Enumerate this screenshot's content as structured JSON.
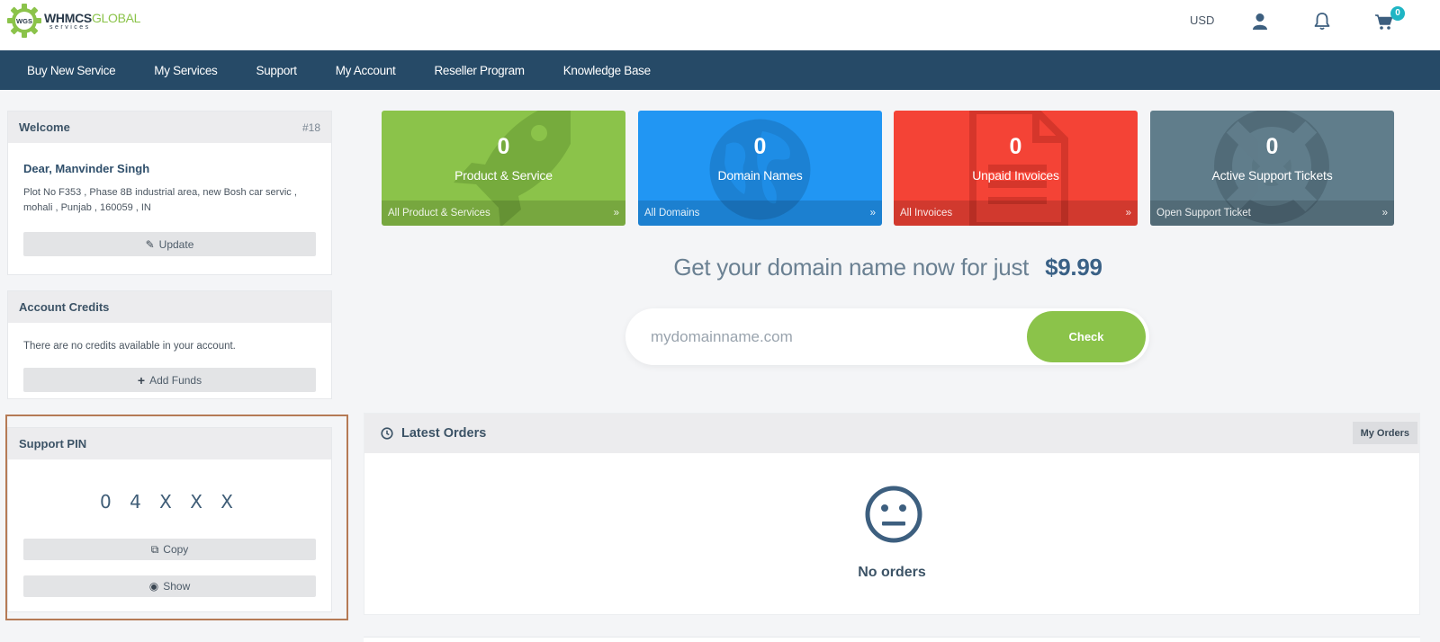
{
  "brand": {
    "name_main": "WHMCS",
    "name_accent": "GLOBAL",
    "tagline": "services",
    "badge": "WGS"
  },
  "header": {
    "currency": "USD",
    "cart_count": "0"
  },
  "nav": [
    "Buy New Service",
    "My Services",
    "Support",
    "My Account",
    "Reseller Program",
    "Knowledge Base"
  ],
  "welcome": {
    "title": "Welcome",
    "client_id": "#18",
    "name": "Dear, Manvinder Singh",
    "address": "Plot No F353 , Phase 8B industrial area, new Bosh car servic , mohali , Punjab , 160059 , IN",
    "update_label": "Update"
  },
  "credits": {
    "title": "Account Credits",
    "message": "There are no credits available in your account.",
    "add_funds_label": "Add Funds"
  },
  "support_pin": {
    "title": "Support PIN",
    "value": "0 4 X X X",
    "copy_label": "Copy",
    "show_label": "Show"
  },
  "tiles": [
    {
      "count": "0",
      "label": "Product & Service",
      "link": "All Product & Services",
      "arrow": "»",
      "color": "#8bc34a"
    },
    {
      "count": "0",
      "label": "Domain Names",
      "link": "All Domains",
      "arrow": "»",
      "color": "#2196f3"
    },
    {
      "count": "0",
      "label": "Unpaid Invoices",
      "link": "All Invoices",
      "arrow": "»",
      "color": "#f44336"
    },
    {
      "count": "0",
      "label": "Active Support Tickets",
      "link": "Open Support Ticket",
      "arrow": "»",
      "color": "#607d8b"
    }
  ],
  "domain": {
    "headline": "Get your domain name now for just",
    "price": "$9.99",
    "placeholder": "mydomainname.com",
    "check_label": "Check"
  },
  "orders": {
    "title": "Latest Orders",
    "my_orders_label": "My Orders",
    "empty_text": "No orders"
  }
}
